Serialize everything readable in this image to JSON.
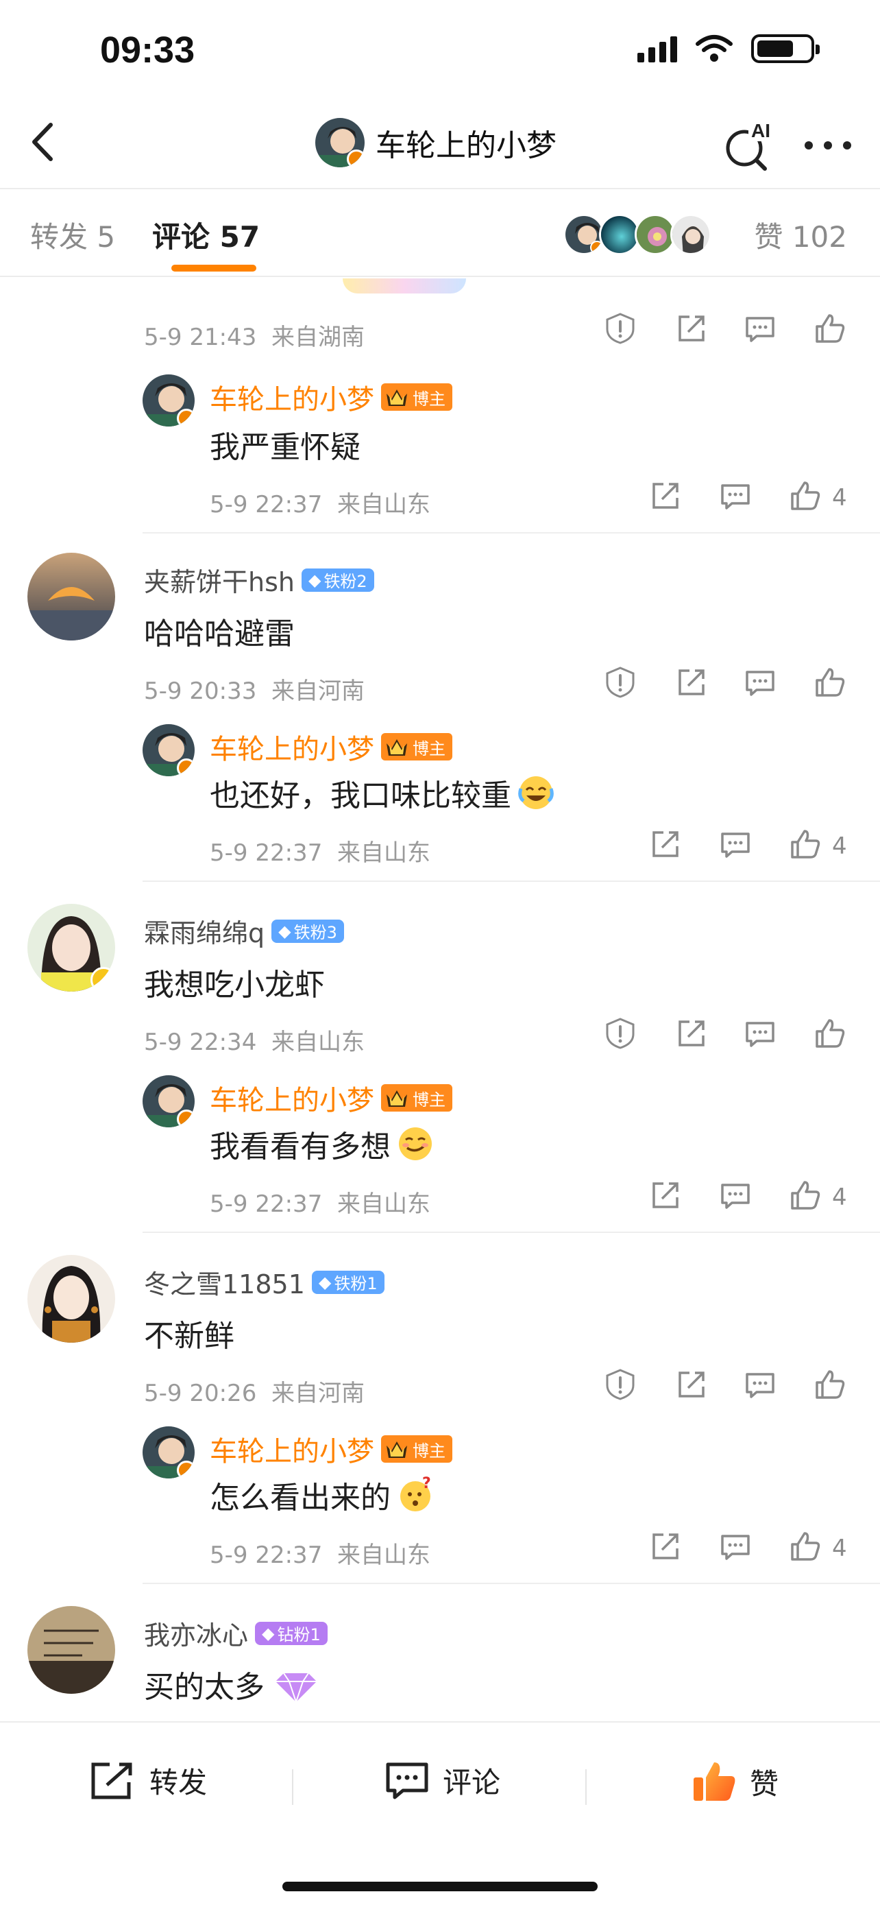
{
  "status_bar": {
    "time": "09:33"
  },
  "nav": {
    "title": "车轮上的小梦",
    "ai_label": "AI"
  },
  "tabs": {
    "repost": "转发 5",
    "comments": "评论 57",
    "likes": "赞 102"
  },
  "colors": {
    "accent": "#ff8200",
    "meta": "#9a9a9a",
    "fan_badge": "#5ea6ff",
    "diamond_badge": "#b57cf2"
  },
  "first_meta": {
    "time": "5-9 21:43",
    "location": "来自湖南"
  },
  "replier": {
    "name": "车轮上的小梦",
    "badge": "博主"
  },
  "replies_like_count": "4",
  "comments": [
    {
      "user": "夹薪饼干hsh",
      "badge": "铁粉2",
      "text": "哈哈哈避雷",
      "time": "5-9 20:33",
      "location": "来自河南",
      "reply": {
        "text": "也还好，我口味比较重",
        "emoji": "laugh-cry-emoji",
        "time": "5-9 22:37",
        "location": "来自山东"
      }
    },
    {
      "user": "霖雨绵绵q",
      "badge": "铁粉3",
      "text": "我想吃小龙虾",
      "time": "5-9 22:34",
      "location": "来自山东",
      "reply": {
        "text": "我看看有多想",
        "emoji": "smirk-emoji",
        "time": "5-9 22:37",
        "location": "来自山东"
      }
    },
    {
      "user": "冬之雪11851",
      "badge": "铁粉1",
      "text": "不新鲜",
      "time": "5-9 20:26",
      "location": "来自河南",
      "reply": {
        "text": "怎么看出来的",
        "emoji": "puzzled-emoji",
        "time": "5-9 22:37",
        "location": "来自山东"
      }
    },
    {
      "user": "我亦冰心",
      "badge": "钻粉1",
      "text": "买的太多"
    }
  ],
  "first_reply": {
    "text": "我严重怀疑",
    "time": "5-9 22:37",
    "location": "来自山东"
  },
  "bottom_bar": {
    "repost": "转发",
    "comment": "评论",
    "like": "赞"
  }
}
